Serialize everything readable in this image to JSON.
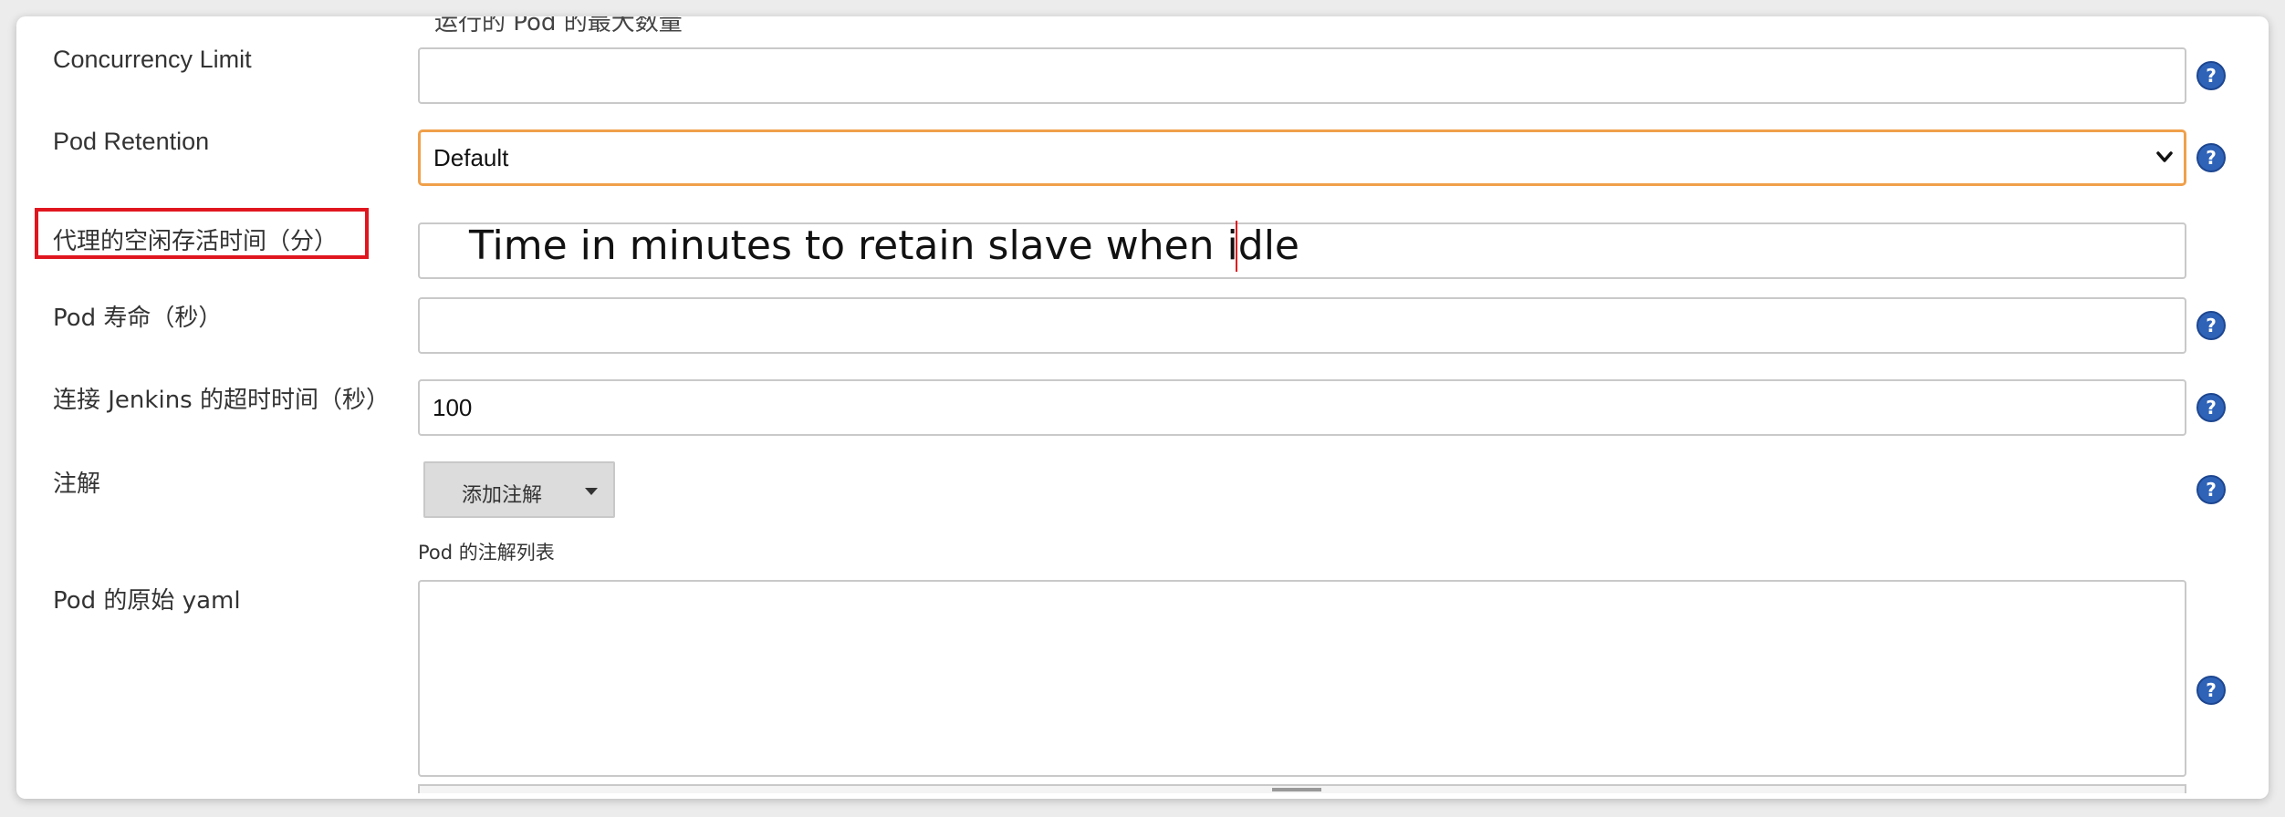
{
  "form": {
    "cut_off_text": "运行的 Pod 的最大数量",
    "concurrency_limit": {
      "label": "Concurrency Limit",
      "value": ""
    },
    "pod_retention": {
      "label": "Pod Retention",
      "selected": "Default"
    },
    "idle_time": {
      "label": "代理的空闲存活时间（分）",
      "value": ""
    },
    "pod_lifetime": {
      "label": "Pod 寿命（秒）",
      "value": ""
    },
    "jenkins_timeout": {
      "label": "连接 Jenkins 的超时时间（秒）",
      "value": "100"
    },
    "annotations": {
      "label": "注解",
      "button_label": "添加注解",
      "hint": "Pod 的注解列表"
    },
    "raw_yaml": {
      "label": "Pod 的原始 yaml",
      "value": ""
    }
  },
  "annotation_overlay": {
    "text": "Time in minutes to retain slave when idle",
    "highlight_color": "#e0161f"
  },
  "colors": {
    "focus_border": "#f0a04b",
    "help_icon": "#2f63b8"
  },
  "icons": {
    "help": "help-circle-icon",
    "select_arrow": "chevron-down-icon",
    "dropdown_arrow": "caret-down-icon"
  }
}
